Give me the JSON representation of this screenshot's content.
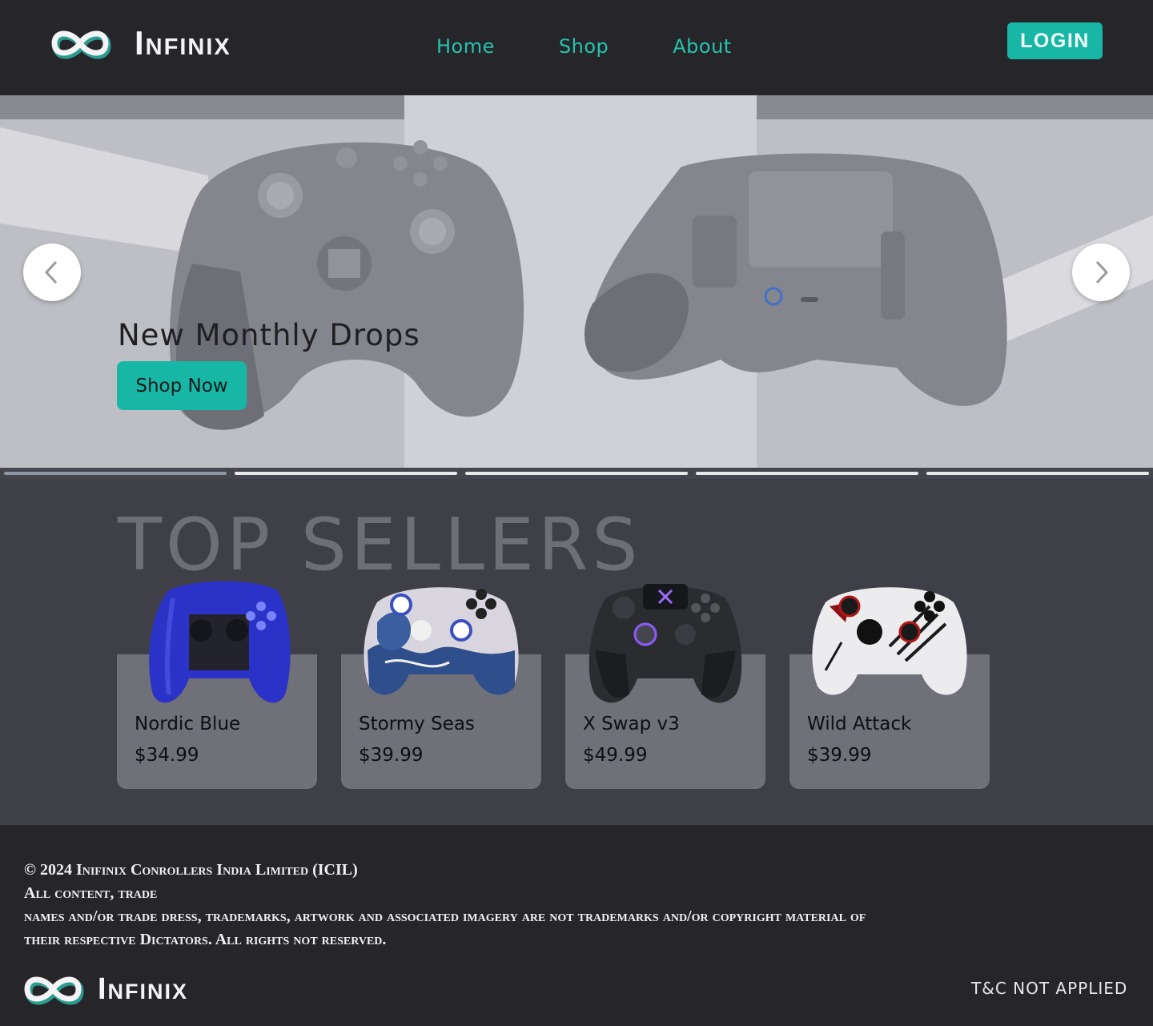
{
  "header": {
    "brand": "Infinix",
    "nav": [
      "Home",
      "Shop",
      "About"
    ],
    "login": "LOGIN"
  },
  "hero": {
    "title": "New Monthly Drops",
    "cta": "Shop Now",
    "prev_icon": "chevron-left-icon",
    "next_icon": "chevron-right-icon",
    "slides_count": 5,
    "active_slide": 1
  },
  "sellers": {
    "title": "TOP SELLERS",
    "products": [
      {
        "name": "Nordic Blue",
        "price": "$34.99"
      },
      {
        "name": "Stormy Seas",
        "price": "$39.99"
      },
      {
        "name": "X Swap v3",
        "price": "$49.99"
      },
      {
        "name": "Wild Attack",
        "price": "$39.99"
      }
    ]
  },
  "footer": {
    "legal_line1": "© 2024 Inifinix Conrollers India Limited (ICIL)",
    "legal_line2": "All content, trade",
    "legal_line3": "names and/or trade dress, trademarks, artwork and associated imagery are not trademarks and/or copyright material of",
    "legal_line4": "their respective Dictators. All rights not reserved.",
    "brand": "Infinix",
    "tnc": "T&C NOT APPLIED"
  },
  "colors": {
    "accent": "#17b6a5",
    "nav_text": "#27c2ae",
    "header_bg": "#26262a",
    "section_bg": "#3f4047",
    "card_bg": "#6f7078"
  }
}
